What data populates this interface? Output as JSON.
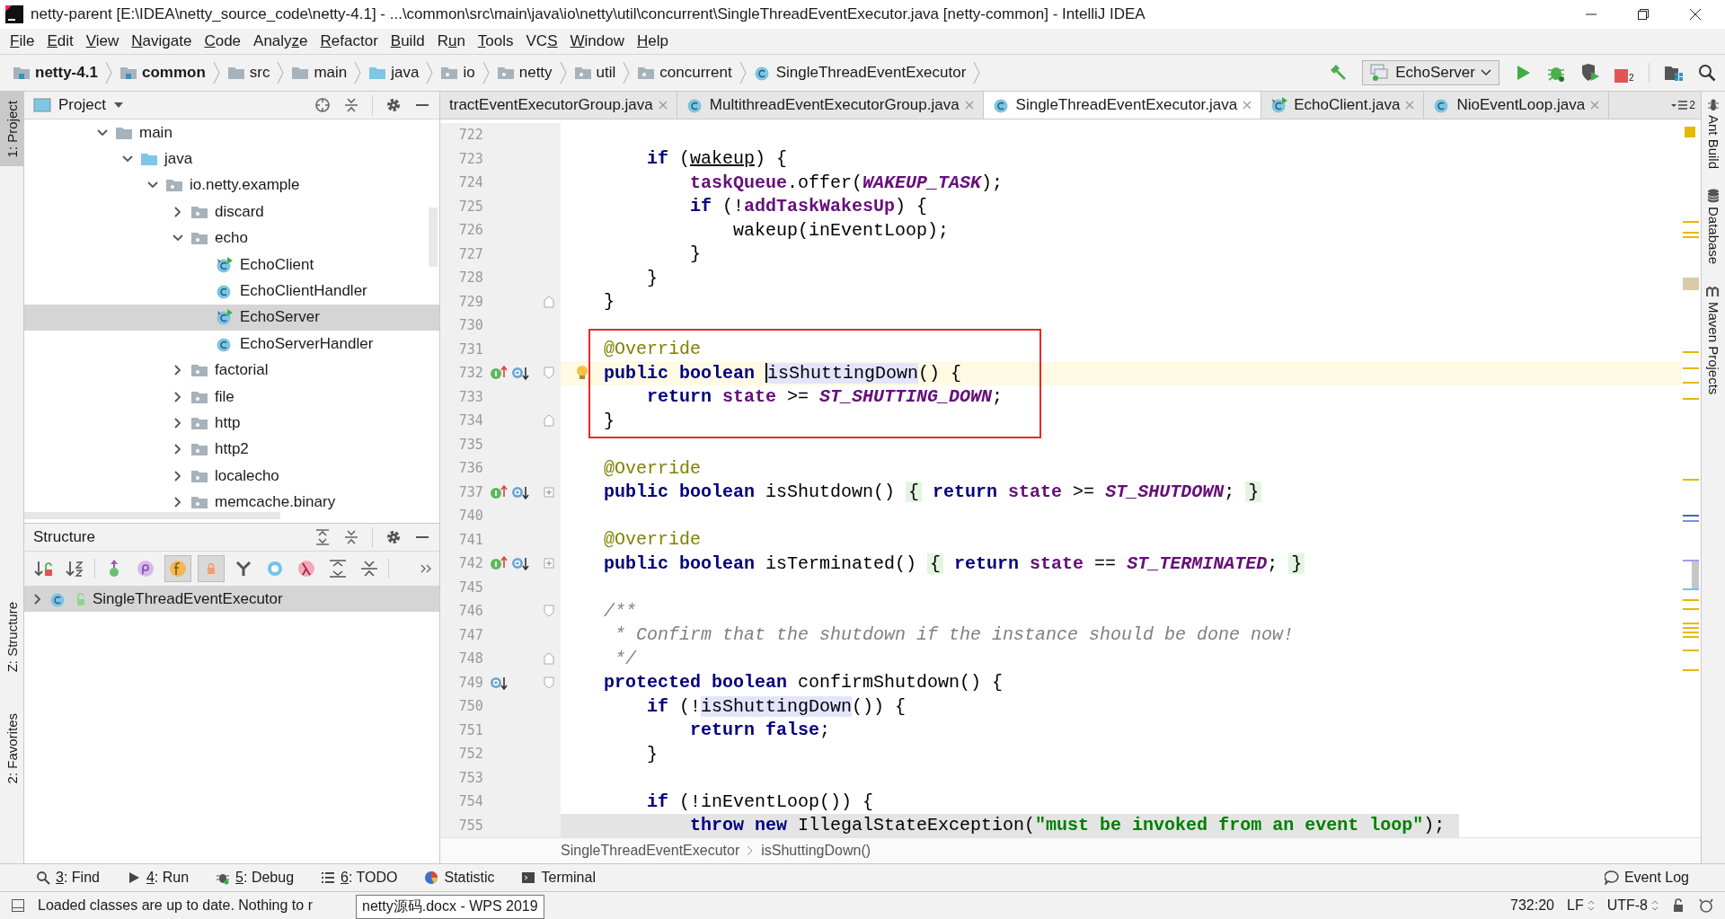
{
  "window": {
    "title": "netty-parent [E:\\IDEA\\netty_source_code\\netty-4.1] - ...\\common\\src\\main\\java\\io\\netty\\util\\concurrent\\SingleThreadEventExecutor.java [netty-common] - IntelliJ IDEA"
  },
  "menu": [
    {
      "key": "F",
      "after": "ile"
    },
    {
      "key": "E",
      "after": "dit"
    },
    {
      "key": "V",
      "after": "iew"
    },
    {
      "key": "N",
      "after": "avigate"
    },
    {
      "key": "C",
      "after": "ode"
    },
    {
      "before": "Analy",
      "key": "z",
      "after": "e"
    },
    {
      "key": "R",
      "after": "efactor"
    },
    {
      "key": "B",
      "after": "uild"
    },
    {
      "before": "R",
      "key": "u",
      "after": "n"
    },
    {
      "key": "T",
      "after": "ools"
    },
    {
      "before": "VC",
      "key": "S"
    },
    {
      "key": "W",
      "after": "indow"
    },
    {
      "key": "H",
      "after": "elp"
    }
  ],
  "nav": {
    "crumbs": [
      {
        "label": "netty-4.1",
        "kind": "module"
      },
      {
        "label": "common",
        "kind": "module"
      },
      {
        "label": "src",
        "kind": "folder"
      },
      {
        "label": "main",
        "kind": "folder"
      },
      {
        "label": "java",
        "kind": "source"
      },
      {
        "label": "io",
        "kind": "package"
      },
      {
        "label": "netty",
        "kind": "package"
      },
      {
        "label": "util",
        "kind": "package"
      },
      {
        "label": "concurrent",
        "kind": "package"
      },
      {
        "label": "SingleThreadEventExecutor",
        "kind": "class"
      }
    ],
    "run_config": "EchoServer",
    "stop_badge": "2"
  },
  "left_stripe": [
    {
      "label": "1: Project",
      "selected": true
    },
    {
      "label": "Z: Structure",
      "selected": false
    },
    {
      "label": "2: Favorites",
      "selected": false
    }
  ],
  "project": {
    "title": "Project",
    "tree": [
      {
        "label": "main",
        "kind": "folder",
        "expanded": true,
        "selected": false,
        "children": [
          {
            "label": "java",
            "kind": "source",
            "expanded": true,
            "selected": false,
            "children": [
              {
                "label": "io.netty.example",
                "kind": "package",
                "expanded": true,
                "selected": false,
                "children": [
                  {
                    "label": "discard",
                    "kind": "package",
                    "expanded": false,
                    "selected": false
                  },
                  {
                    "label": "echo",
                    "kind": "package",
                    "expanded": true,
                    "selected": false,
                    "children": [
                      {
                        "label": "EchoClient",
                        "kind": "runnable-class",
                        "selected": false
                      },
                      {
                        "label": "EchoClientHandler",
                        "kind": "class",
                        "selected": false
                      },
                      {
                        "label": "EchoServer",
                        "kind": "runnable-class",
                        "selected": true
                      },
                      {
                        "label": "EchoServerHandler",
                        "kind": "class",
                        "selected": false
                      }
                    ]
                  },
                  {
                    "label": "factorial",
                    "kind": "package",
                    "expanded": false,
                    "selected": false
                  },
                  {
                    "label": "file",
                    "kind": "package",
                    "expanded": false,
                    "selected": false
                  },
                  {
                    "label": "http",
                    "kind": "package",
                    "expanded": false,
                    "selected": false
                  },
                  {
                    "label": "http2",
                    "kind": "package",
                    "expanded": false,
                    "selected": false
                  },
                  {
                    "label": "localecho",
                    "kind": "package",
                    "expanded": false,
                    "selected": false
                  },
                  {
                    "label": "memcache.binary",
                    "kind": "package",
                    "expanded": false,
                    "selected": false
                  }
                ]
              }
            ]
          }
        ]
      }
    ]
  },
  "structure": {
    "title": "Structure",
    "tools": [
      {
        "kind": "sort-visibility",
        "selected": false
      },
      {
        "kind": "sort-alpha",
        "selected": false
      },
      {
        "kind": "inherited",
        "selected": false
      },
      {
        "kind": "properties",
        "selected": false
      },
      {
        "kind": "fields",
        "selected": true
      },
      {
        "kind": "non-public",
        "selected": true
      },
      {
        "kind": "fork",
        "selected": false
      },
      {
        "kind": "anonymous",
        "selected": false
      },
      {
        "kind": "lambdas",
        "selected": false
      },
      {
        "kind": "expand",
        "selected": false
      },
      {
        "kind": "collapse",
        "selected": false
      }
    ],
    "items": [
      {
        "label": "SingleThreadEventExecutor",
        "expanded": false,
        "selected": true
      }
    ]
  },
  "tabs": [
    {
      "label": "tractEventExecutorGroup.java",
      "kind": "none",
      "selected": false
    },
    {
      "label": "MultithreadEventExecutorGroup.java",
      "kind": "class",
      "selected": false
    },
    {
      "label": "SingleThreadEventExecutor.java",
      "kind": "class",
      "selected": true
    },
    {
      "label": "EchoClient.java",
      "kind": "runnable-class",
      "selected": false
    },
    {
      "label": "NioEventLoop.java",
      "kind": "class",
      "selected": false
    }
  ],
  "tabs_overflow": "2",
  "editor": {
    "lines": [
      {
        "n": "722"
      },
      {
        "n": "723",
        "tokens": [
          {
            "text": "    if",
            "kind": "kw"
          },
          {
            "text": " (",
            "kind": "plain"
          },
          {
            "text": "wakeup",
            "kind": "underlined"
          },
          {
            "text": ") {",
            "kind": "plain"
          }
        ]
      },
      {
        "n": "724",
        "tokens": [
          {
            "text": "        taskQueue",
            "kind": "field"
          },
          {
            "text": ".offer(",
            "kind": "plain"
          },
          {
            "text": "WAKEUP_TASK",
            "kind": "const"
          },
          {
            "text": ");",
            "kind": "plain"
          }
        ]
      },
      {
        "n": "725",
        "tokens": [
          {
            "text": "        if",
            "kind": "kw"
          },
          {
            "text": " (!",
            "kind": "plain"
          },
          {
            "text": "addTaskWakesUp",
            "kind": "field"
          },
          {
            "text": ") {",
            "kind": "plain"
          }
        ]
      },
      {
        "n": "726",
        "tokens": [
          {
            "text": "            wakeup(inEventLoop);",
            "kind": "plain"
          }
        ]
      },
      {
        "n": "727",
        "tokens": [
          {
            "text": "        }",
            "kind": "plain"
          }
        ]
      },
      {
        "n": "728",
        "tokens": [
          {
            "text": "    }",
            "kind": "plain"
          }
        ]
      },
      {
        "n": "729",
        "fold": {
          "kind": "end"
        },
        "tokens": [
          {
            "text": "}",
            "kind": "plain"
          }
        ]
      },
      {
        "n": "730"
      },
      {
        "n": "731",
        "boxed": true,
        "tokens": [
          {
            "text": "@Override",
            "kind": "ann"
          }
        ]
      },
      {
        "n": "732",
        "boxed": true,
        "current": true,
        "bulb": true,
        "fold": {
          "kind": "start"
        },
        "gutter": [
          {
            "kind": "implements"
          },
          {
            "kind": "overridden"
          }
        ],
        "tokens": [
          {
            "text": "public boolean ",
            "kind": "kw"
          },
          {
            "text": "isShuttingDown",
            "kind": "usage",
            "caret": true
          },
          {
            "text": "() {",
            "kind": "plain"
          }
        ]
      },
      {
        "n": "733",
        "boxed": true,
        "tokens": [
          {
            "text": "    return ",
            "kind": "kw"
          },
          {
            "text": "state",
            "kind": "field"
          },
          {
            "text": " >= ",
            "kind": "plain"
          },
          {
            "text": "ST_SHUTTING_DOWN",
            "kind": "const"
          },
          {
            "text": ";",
            "kind": "plain"
          }
        ]
      },
      {
        "n": "734",
        "boxed": true,
        "fold": {
          "kind": "end"
        },
        "tokens": [
          {
            "text": "}",
            "kind": "plain"
          }
        ]
      },
      {
        "n": "735"
      },
      {
        "n": "736",
        "tokens": [
          {
            "text": "@Override",
            "kind": "ann"
          }
        ]
      },
      {
        "n": "737",
        "fold": {
          "kind": "collapsed"
        },
        "gutter": [
          {
            "kind": "implements"
          },
          {
            "kind": "overridden"
          }
        ],
        "tokens": [
          {
            "text": "public boolean ",
            "kind": "kw"
          },
          {
            "text": "isShutdown() ",
            "kind": "plain"
          },
          {
            "text": "{",
            "kind": "fold"
          },
          {
            "text": " return ",
            "kind": "kw"
          },
          {
            "text": "state",
            "kind": "field"
          },
          {
            "text": " >= ",
            "kind": "plain"
          },
          {
            "text": "ST_SHUTDOWN",
            "kind": "const"
          },
          {
            "text": "; ",
            "kind": "plain"
          },
          {
            "text": "}",
            "kind": "fold"
          }
        ]
      },
      {
        "n": "740"
      },
      {
        "n": "741",
        "tokens": [
          {
            "text": "@Override",
            "kind": "ann"
          }
        ]
      },
      {
        "n": "742",
        "fold": {
          "kind": "collapsed"
        },
        "gutter": [
          {
            "kind": "implements"
          },
          {
            "kind": "overridden"
          }
        ],
        "tokens": [
          {
            "text": "public boolean ",
            "kind": "kw"
          },
          {
            "text": "isTerminated() ",
            "kind": "plain"
          },
          {
            "text": "{",
            "kind": "fold"
          },
          {
            "text": " return ",
            "kind": "kw"
          },
          {
            "text": "state",
            "kind": "field"
          },
          {
            "text": " == ",
            "kind": "plain"
          },
          {
            "text": "ST_TERMINATED",
            "kind": "const"
          },
          {
            "text": "; ",
            "kind": "plain"
          },
          {
            "text": "}",
            "kind": "fold"
          }
        ]
      },
      {
        "n": "745"
      },
      {
        "n": "746",
        "fold": {
          "kind": "start"
        },
        "tokens": [
          {
            "text": "/**",
            "kind": "comment"
          }
        ]
      },
      {
        "n": "747",
        "tokens": [
          {
            "text": " * Confirm that the shutdown if the instance should be done now!",
            "kind": "comment"
          }
        ]
      },
      {
        "n": "748",
        "fold": {
          "kind": "end"
        },
        "tokens": [
          {
            "text": " */",
            "kind": "comment"
          }
        ]
      },
      {
        "n": "749",
        "fold": {
          "kind": "start"
        },
        "gutter": [
          {
            "kind": "overridden"
          }
        ],
        "tokens": [
          {
            "text": "protected boolean ",
            "kind": "kw"
          },
          {
            "text": "confirmShutdown() {",
            "kind": "plain"
          }
        ]
      },
      {
        "n": "750",
        "tokens": [
          {
            "text": "    if",
            "kind": "kw"
          },
          {
            "text": " (!",
            "kind": "plain"
          },
          {
            "text": "isShuttingDown",
            "kind": "usage"
          },
          {
            "text": "()) {",
            "kind": "plain"
          }
        ]
      },
      {
        "n": "751",
        "tokens": [
          {
            "text": "        return false",
            "kind": "kw"
          },
          {
            "text": ";",
            "kind": "plain"
          }
        ]
      },
      {
        "n": "752",
        "tokens": [
          {
            "text": "    }",
            "kind": "plain"
          }
        ]
      },
      {
        "n": "753"
      },
      {
        "n": "754",
        "tokens": [
          {
            "text": "    if",
            "kind": "kw"
          },
          {
            "text": " (!inEventLoop()) {",
            "kind": "plain"
          }
        ]
      },
      {
        "n": "755",
        "shaded": true,
        "tokens": [
          {
            "text": "        throw new ",
            "kind": "kw"
          },
          {
            "text": "IllegalStateException(",
            "kind": "plain"
          },
          {
            "text": "\"must be invoked from an event loop\"",
            "kind": "str"
          },
          {
            "text": ");",
            "kind": "plain"
          }
        ]
      }
    ],
    "breadcrumb": [
      "SingleThreadEventExecutor",
      "isShuttingDown()"
    ]
  },
  "right_stripe": [
    {
      "label": "Ant Build",
      "kind": "ant"
    },
    {
      "label": "Database",
      "kind": "database"
    },
    {
      "label": "Maven Projects",
      "kind": "maven"
    }
  ],
  "tool_buttons": [
    {
      "key": "3",
      "after": ": Find",
      "kind": "search"
    },
    {
      "key": "4",
      "after": ": Run",
      "kind": "run"
    },
    {
      "key": "5",
      "after": ": Debug",
      "kind": "debug"
    },
    {
      "key": "6",
      "after": ": TODO",
      "kind": "todo"
    },
    {
      "label": "Statistic",
      "kind": "statistic"
    },
    {
      "label": "Terminal",
      "kind": "terminal"
    }
  ],
  "event_log": "Event Log",
  "status": {
    "message": "Loaded classes are up to date. Nothing to r",
    "tooltip": "netty源码.docx - WPS 2019",
    "position": "732:20",
    "line_separator": "LF",
    "encoding": "UTF-8"
  }
}
